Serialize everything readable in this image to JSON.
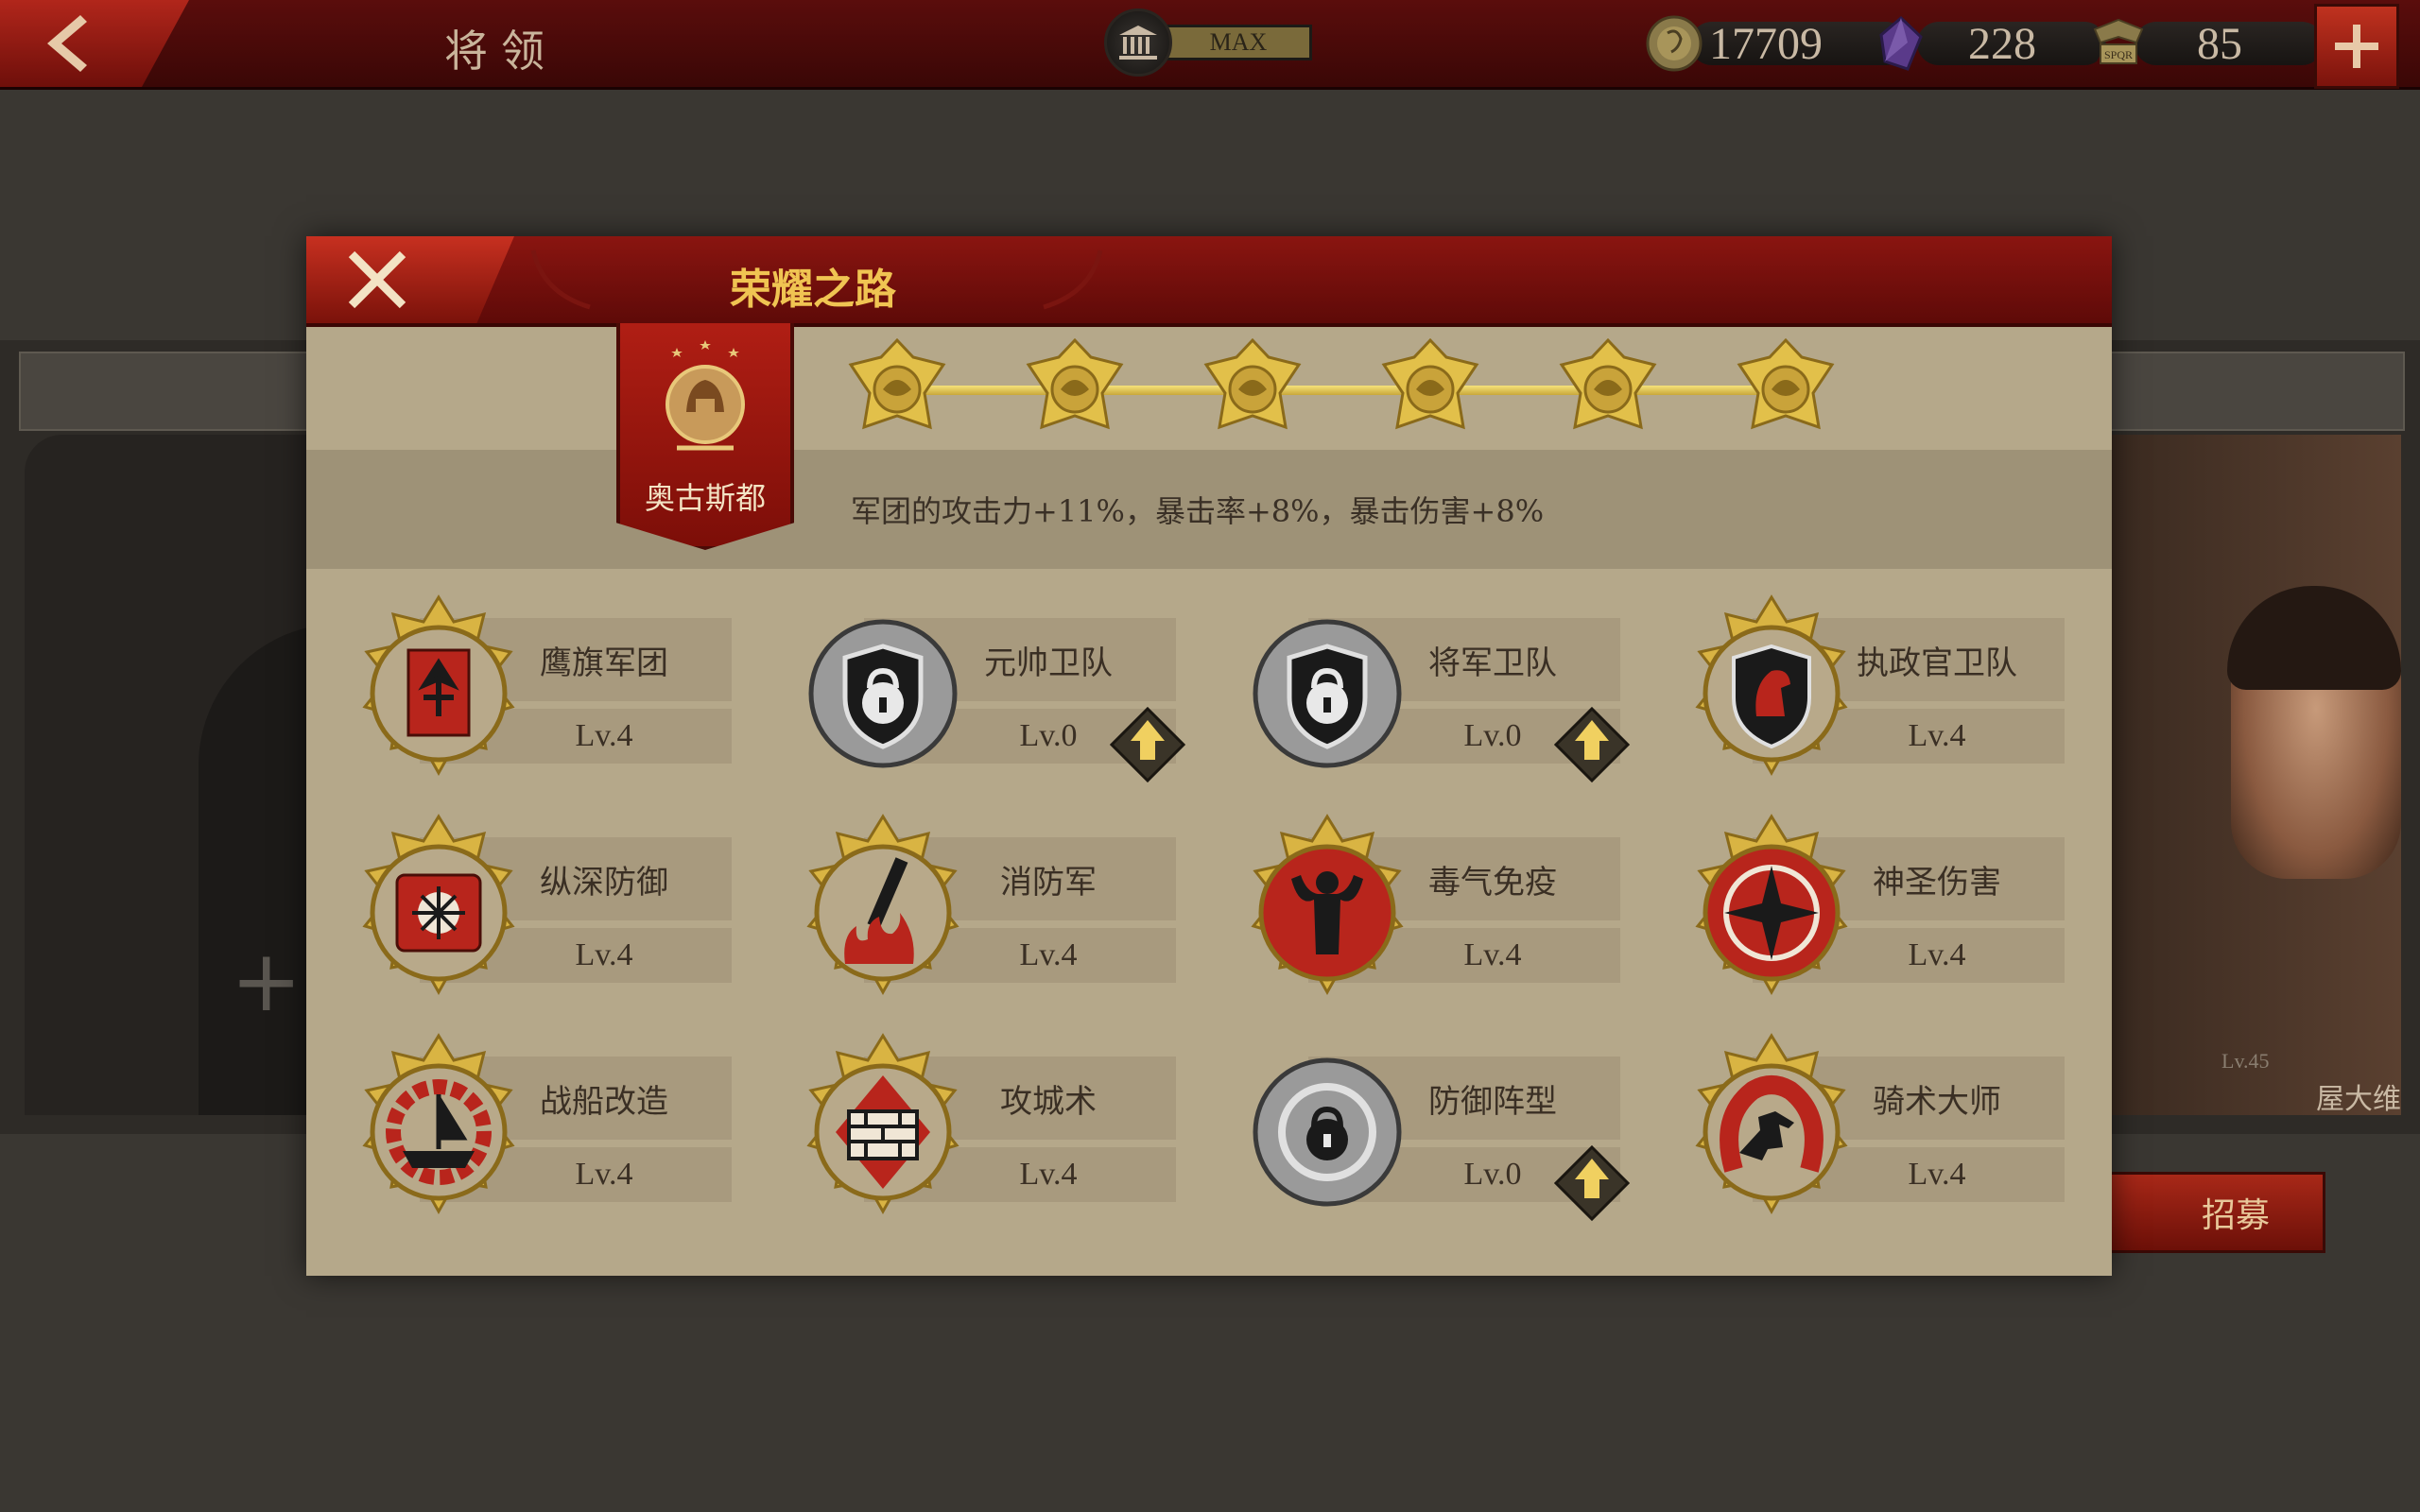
{
  "topbar": {
    "title": "将领",
    "level_text": "MAX",
    "coins": "17709",
    "gems": "228",
    "tokens": "85"
  },
  "background": {
    "hero_level": "Lv.45",
    "hero_name": "屋大维",
    "recruit_label": "招募"
  },
  "dialog": {
    "title": "荣耀之路",
    "commander_name": "奥古斯都",
    "stars_count": 6,
    "bonus_text": "军团的攻击力+11%，暴击率+8%，暴击伤害+8%"
  },
  "skills": [
    {
      "name": "鹰旗军团",
      "level": "Lv.4",
      "unlocked": true,
      "icon": "eagle-banner-icon"
    },
    {
      "name": "元帅卫队",
      "level": "Lv.0",
      "unlocked": false,
      "icon": "locked-shield-icon"
    },
    {
      "name": "将军卫队",
      "level": "Lv.0",
      "unlocked": false,
      "icon": "locked-shield-icon"
    },
    {
      "name": "执政官卫队",
      "level": "Lv.4",
      "unlocked": true,
      "icon": "horse-shield-icon"
    },
    {
      "name": "纵深防御",
      "level": "Lv.4",
      "unlocked": true,
      "icon": "defense-shield-icon"
    },
    {
      "name": "消防军",
      "level": "Lv.4",
      "unlocked": true,
      "icon": "torch-fire-icon"
    },
    {
      "name": "毒气免疫",
      "level": "Lv.4",
      "unlocked": true,
      "icon": "strongman-icon"
    },
    {
      "name": "神圣伤害",
      "level": "Lv.4",
      "unlocked": true,
      "icon": "holy-star-icon"
    },
    {
      "name": "战船改造",
      "level": "Lv.4",
      "unlocked": true,
      "icon": "ship-gear-icon"
    },
    {
      "name": "攻城术",
      "level": "Lv.4",
      "unlocked": true,
      "icon": "wall-siege-icon"
    },
    {
      "name": "防御阵型",
      "level": "Lv.0",
      "unlocked": false,
      "icon": "locked-cycle-icon"
    },
    {
      "name": "骑术大师",
      "level": "Lv.4",
      "unlocked": true,
      "icon": "horseshoe-horse-icon"
    }
  ],
  "colors": {
    "header_red": "#8a1510",
    "title_gold": "#f0c452",
    "parchment": "#b5a88a",
    "skill_red": "#b8251c",
    "locked_gray": "#9a9a9a"
  }
}
